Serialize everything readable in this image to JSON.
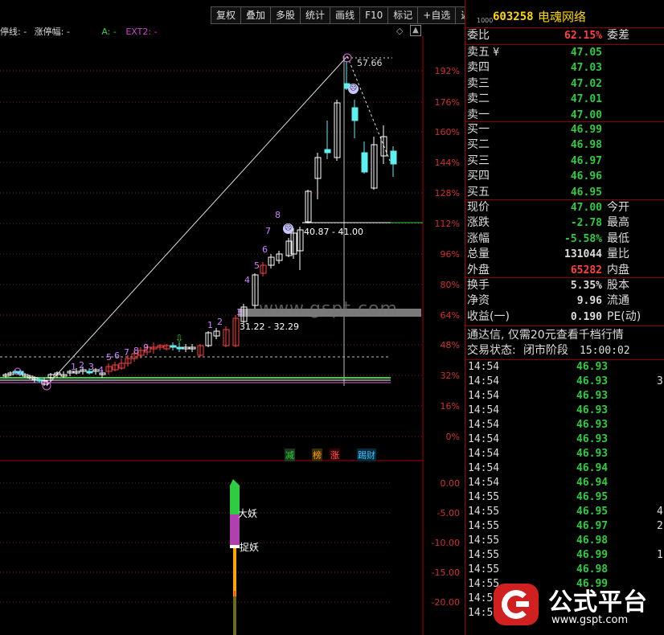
{
  "toolbar": [
    "复权",
    "叠加",
    "多股",
    "统计",
    "画线",
    "F10",
    "标记",
    "+自选",
    "返回"
  ],
  "legend": {
    "a": "停线: -",
    "b": "涨停幅: -",
    "c": "A: -",
    "d": "EXT2: -"
  },
  "y_axis_labels": [
    "192%",
    "176%",
    "160%",
    "144%",
    "128%",
    "112%",
    "96%",
    "80%",
    "64%",
    "48%",
    "32%",
    "16%",
    "0%"
  ],
  "sub_axis_labels": [
    "0.00",
    "-5.00",
    "-10.00",
    "-15.00",
    "-20.00"
  ],
  "annotations": {
    "high": "57.66",
    "range1": "40.87 - 41.00",
    "range2": "31.22 - 32.29",
    "watermark_site": "www.gspt.com",
    "tag_da": "大妖",
    "tag_zhuo": "捉妖",
    "mini_tags": [
      "减",
      "榜",
      "涨",
      "踢财"
    ]
  },
  "seq_labels": [
    "1",
    "2",
    "3",
    "4",
    "5",
    "6",
    "7",
    "8",
    "9",
    "1",
    "2",
    "3",
    "4",
    "5",
    "6",
    "7",
    "8",
    "9"
  ],
  "stock": {
    "code": "603258",
    "name": "电魂网络",
    "prefix": "1000"
  },
  "weibi": {
    "label": "委比",
    "value": "62.15%",
    "label2": "委差"
  },
  "asks": [
    {
      "label": "卖五",
      "mark": "¥",
      "price": "47.05"
    },
    {
      "label": "卖四",
      "price": "47.03"
    },
    {
      "label": "卖三",
      "price": "47.02"
    },
    {
      "label": "卖二",
      "price": "47.01"
    },
    {
      "label": "卖一",
      "price": "47.00"
    }
  ],
  "bids": [
    {
      "label": "买一",
      "price": "46.99"
    },
    {
      "label": "买二",
      "price": "46.98"
    },
    {
      "label": "买三",
      "price": "46.97"
    },
    {
      "label": "买四",
      "price": "46.96"
    },
    {
      "label": "买五",
      "price": "46.95"
    }
  ],
  "quote": [
    {
      "label": "现价",
      "value": "47.00",
      "label2": "今开"
    },
    {
      "label": "涨跌",
      "value": "-2.78",
      "label2": "最高"
    },
    {
      "label": "涨幅",
      "value": "-5.58%",
      "label2": "最低"
    },
    {
      "label": "总量",
      "value": "131044",
      "label2": "量比"
    },
    {
      "label": "外盘",
      "value": "65282",
      "label2": "内盘"
    }
  ],
  "stats": [
    {
      "label": "换手",
      "value": "5.35%",
      "label2": "股本"
    },
    {
      "label": "净资",
      "value": "9.96",
      "label2": "流通"
    },
    {
      "label": "收益(一)",
      "value": "0.190",
      "label2": "PE(动)"
    }
  ],
  "notice": "通达信, 仅需20元查看千档行情",
  "status": {
    "label": "交易状态:",
    "value": "闭市阶段",
    "time": "15:00:02"
  },
  "ticks": [
    {
      "time": "14:54",
      "price": "46.93",
      "vol": ""
    },
    {
      "time": "14:54",
      "price": "46.93",
      "vol": "3"
    },
    {
      "time": "14:54",
      "price": "46.93",
      "vol": ""
    },
    {
      "time": "14:54",
      "price": "46.93",
      "vol": ""
    },
    {
      "time": "14:54",
      "price": "46.93",
      "vol": ""
    },
    {
      "time": "14:54",
      "price": "46.93",
      "vol": ""
    },
    {
      "time": "14:54",
      "price": "46.93",
      "vol": ""
    },
    {
      "time": "14:54",
      "price": "46.94",
      "vol": ""
    },
    {
      "time": "14:54",
      "price": "46.94",
      "vol": ""
    },
    {
      "time": "14:55",
      "price": "46.95",
      "vol": ""
    },
    {
      "time": "14:55",
      "price": "46.95",
      "vol": "4"
    },
    {
      "time": "14:55",
      "price": "46.97",
      "vol": "2"
    },
    {
      "time": "14:55",
      "price": "46.98",
      "vol": ""
    },
    {
      "time": "14:55",
      "price": "46.99",
      "vol": "1"
    },
    {
      "time": "14:55",
      "price": "46.98",
      "vol": ""
    },
    {
      "time": "14:55",
      "price": "46.99",
      "vol": ""
    },
    {
      "time": "14:55",
      "price": "",
      "vol": ""
    },
    {
      "time": "14:55",
      "price": "",
      "vol": ""
    }
  ],
  "watermark_brand": {
    "text": "公式平台",
    "url": "www.gspt.com"
  }
}
